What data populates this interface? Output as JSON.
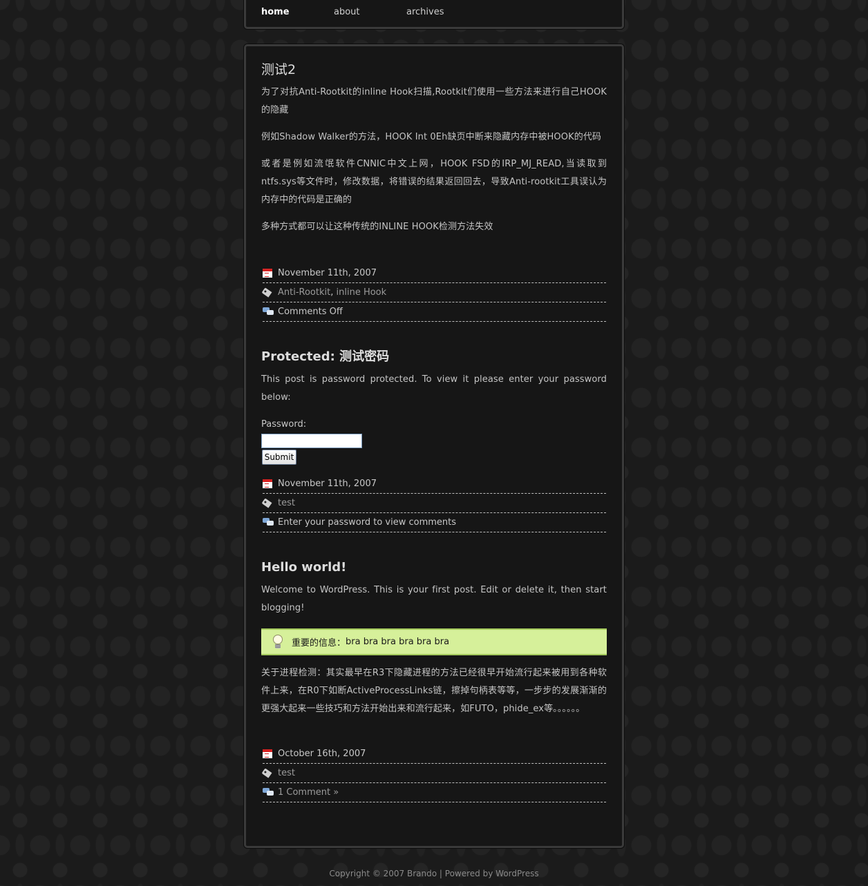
{
  "nav": {
    "items": [
      {
        "label": "home"
      },
      {
        "label": "about"
      },
      {
        "label": "archives"
      }
    ]
  },
  "posts": [
    {
      "title": "测试2",
      "paragraphs": [
        "为了对抗Anti-Rootkit的inline Hook扫描,Rootkit们使用一些方法来进行自己HOOK的隐藏",
        "例如Shadow Walker的方法，HOOK Int 0Eh缺页中断来隐藏内存中被HOOK的代码",
        "或者是例如流氓软件CNNIC中文上网，HOOK FSD的IRP_MJ_READ,当读取到ntfs.sys等文件时，修改数据，将错误的结果返回回去，导致Anti-rootkit工具误认为内存中的代码是正确的",
        "多种方式都可以让这种传统的INLINE HOOK检测方法失效"
      ],
      "date": "November 11th, 2007",
      "tags": [
        "Anti-Rootkit",
        "inline Hook"
      ],
      "tag_separator": ", ",
      "comments": "Comments Off"
    },
    {
      "title": "Protected: 测试密码",
      "message": "This post is password protected. To view it please enter your password below:",
      "password_label": "Password:",
      "password_value": "",
      "submit_label": "Submit",
      "date": "November 11th, 2007",
      "tags": [
        "test"
      ],
      "comments": "Enter your password to view comments"
    },
    {
      "title": "Hello world!",
      "intro": "Welcome to WordPress. This is your first post. Edit or delete it, then start blogging!",
      "notice_label": "重要的信息：",
      "notice_text": "bra bra bra bra bra bra",
      "body": "关于进程检测：其实最早在R3下隐藏进程的方法已经很早开始流行起来被用到各种软件上来，在R0下如断ActiveProcessLinks链，擦掉句柄表等等，一步步的发展渐渐的更强大起来一些技巧和方法开始出来和流行起来，如FUTO，phide_ex等。。。。。。",
      "date": "October 16th, 2007",
      "tags": [
        "test"
      ],
      "comments": "1 Comment »"
    }
  ],
  "footer": {
    "prefix": "Copyright © 2007 ",
    "site": "Brando",
    "separator": " | Powered by ",
    "powered": "WordPress"
  },
  "icons": {
    "date": "calendar-icon",
    "tags": "tag-icon",
    "comments": "comments-icon",
    "notice": "lightbulb-icon"
  },
  "colors": {
    "panel": "#161616",
    "notice_bg": "#d6f09a",
    "calendar_red": "#d42222"
  }
}
